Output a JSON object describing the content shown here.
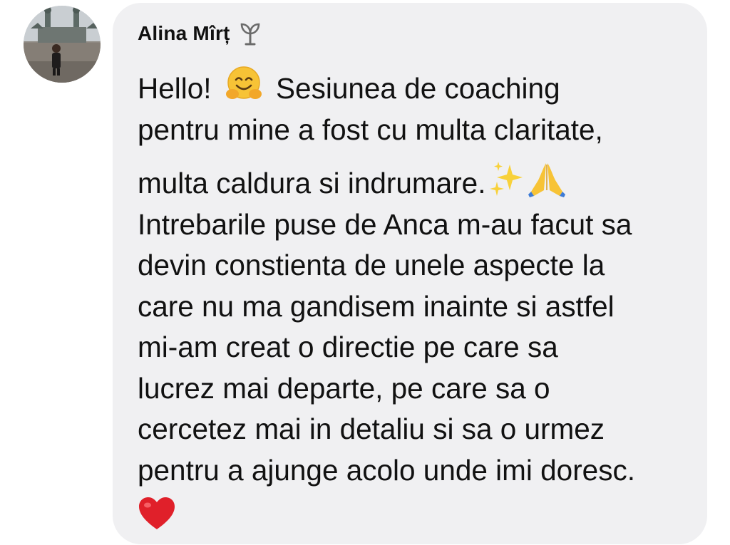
{
  "comment": {
    "author": "Alina Mîrț",
    "badge_icon": "rising-star-badge-icon",
    "lines": [
      {
        "before": "Hello! ",
        "emoji": "hugging-face-emoji",
        "after": " Sesiunea de coaching"
      },
      {
        "text": "pentru mine a fost cu multa claritate,"
      },
      {
        "before": "multa caldura si indrumare.",
        "emoji": "sparkles-emoji",
        "emoji2": "folded-hands-emoji"
      },
      {
        "text": "Intrebarile puse de Anca m-au facut sa"
      },
      {
        "text": "devin constienta de unele aspecte la"
      },
      {
        "text": "care nu ma gandisem inainte si astfel"
      },
      {
        "text": "mi-am creat o directie pe care sa"
      },
      {
        "text": "lucrez mai departe, pe care sa o"
      },
      {
        "text": "cercetez mai in detaliu si sa o urmez"
      },
      {
        "text": "pentru a ajunge acolo unde imi doresc."
      }
    ],
    "closing_emoji": "red-heart-emoji"
  },
  "colors": {
    "bubble": "#f0f0f2",
    "text": "#111111",
    "badge": "#6b6b6b",
    "heart": "#e0202a"
  }
}
